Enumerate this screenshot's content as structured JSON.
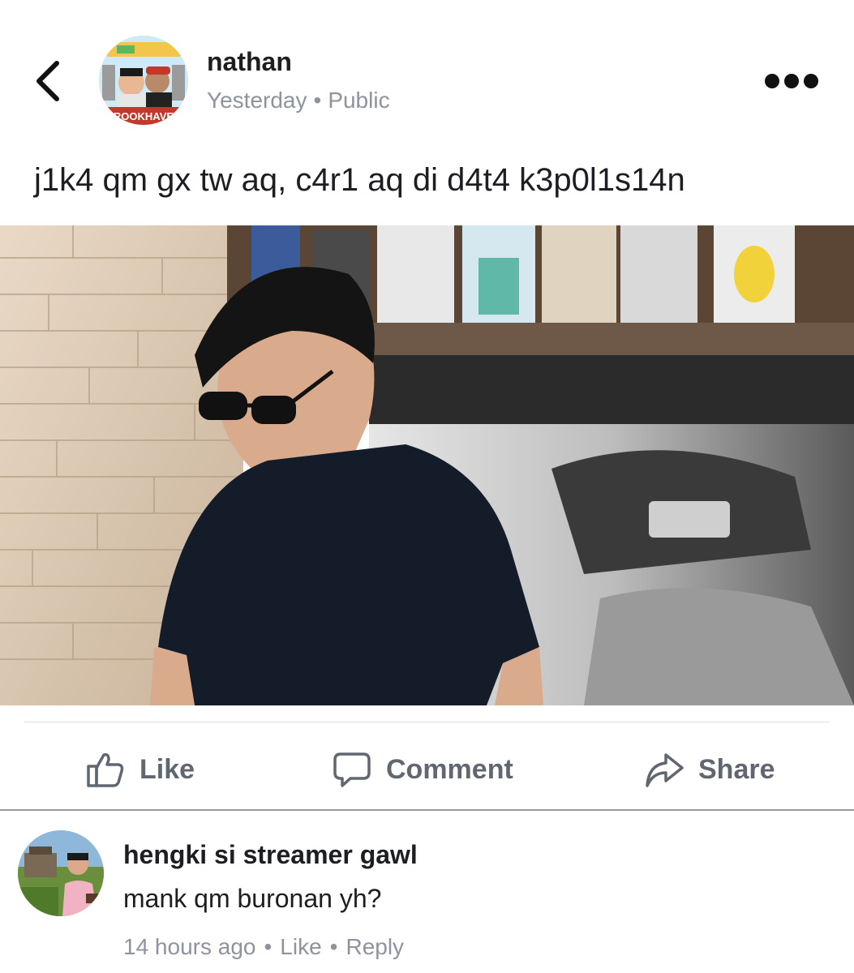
{
  "post": {
    "author": "nathan",
    "time": "Yesterday",
    "separator": "•",
    "audience": "Public",
    "text": "j1k4 qm gx tw aq, c4r1 aq di d4t4 k3p0l1s14n",
    "avatar_badge_text": "BROOKHAVEN"
  },
  "actions": {
    "like": "Like",
    "comment": "Comment",
    "share": "Share"
  },
  "comment": {
    "author": "hengki si streamer gawl",
    "text": "mank qm buronan yh?",
    "time": "14 hours ago",
    "separator": "•",
    "like": "Like",
    "reply": "Reply"
  },
  "icons": {
    "back": "chevron-left-icon",
    "more": "more-dots-icon",
    "like": "thumbs-up-icon",
    "comment": "speech-bubble-icon",
    "share": "share-arrow-icon"
  },
  "colors": {
    "text": "#1c1e21",
    "muted": "#8d949e",
    "action": "#606770",
    "divider": "#dadde1"
  }
}
